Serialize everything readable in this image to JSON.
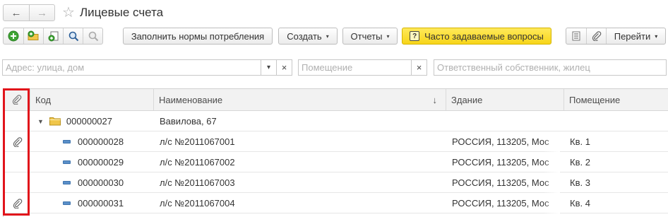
{
  "header": {
    "back_glyph": "←",
    "forward_glyph": "→",
    "favorite_glyph": "☆",
    "title": "Лицевые счета"
  },
  "toolbar": {
    "icons": [
      "add-icon",
      "add-folder-icon",
      "copy-icon",
      "search-icon",
      "cancel-search-icon"
    ],
    "fill_norms_label": "Заполнить нормы потребления",
    "create_label": "Создать",
    "reports_label": "Отчеты",
    "faq_label": "Часто задаваемые вопросы",
    "faq_icon_glyph": "?",
    "goto_label": "Перейти",
    "caret": "▾",
    "accent_yellow": "#f7d51a"
  },
  "filters": {
    "address_placeholder": "Адрес: улица, дом",
    "dropdown_glyph": "▾",
    "clear_glyph": "×",
    "room_placeholder": "Помещение",
    "owner_placeholder": "Ответственный собственник, жилец"
  },
  "table": {
    "columns": {
      "code": "Код",
      "name": "Наименование",
      "sort_glyph": "↓",
      "building": "Здание",
      "room": "Помещение"
    },
    "group_row": {
      "expand_glyph": "▼",
      "code": "000000027",
      "name": "Вавилова, 67"
    },
    "rows": [
      {
        "attachment": true,
        "code": "000000028",
        "name": "л/с №2011067001",
        "building": "РОССИЯ, 113205, Мос",
        "room": "Кв. 1"
      },
      {
        "attachment": false,
        "code": "000000029",
        "name": "л/с №2011067002",
        "building": "РОССИЯ, 113205, Мос",
        "room": "Кв. 2"
      },
      {
        "attachment": false,
        "code": "000000030",
        "name": "л/с №2011067003",
        "building": "РОССИЯ, 113205, Мос",
        "room": "Кв. 3"
      },
      {
        "attachment": true,
        "code": "000000031",
        "name": "л/с №2011067004",
        "building": "РОССИЯ, 113205, Мос",
        "room": "Кв. 4"
      }
    ]
  },
  "colors": {
    "highlight_box": "#e1141b",
    "folder": "#f0c64a",
    "item_marker": "#5a8fc9"
  }
}
